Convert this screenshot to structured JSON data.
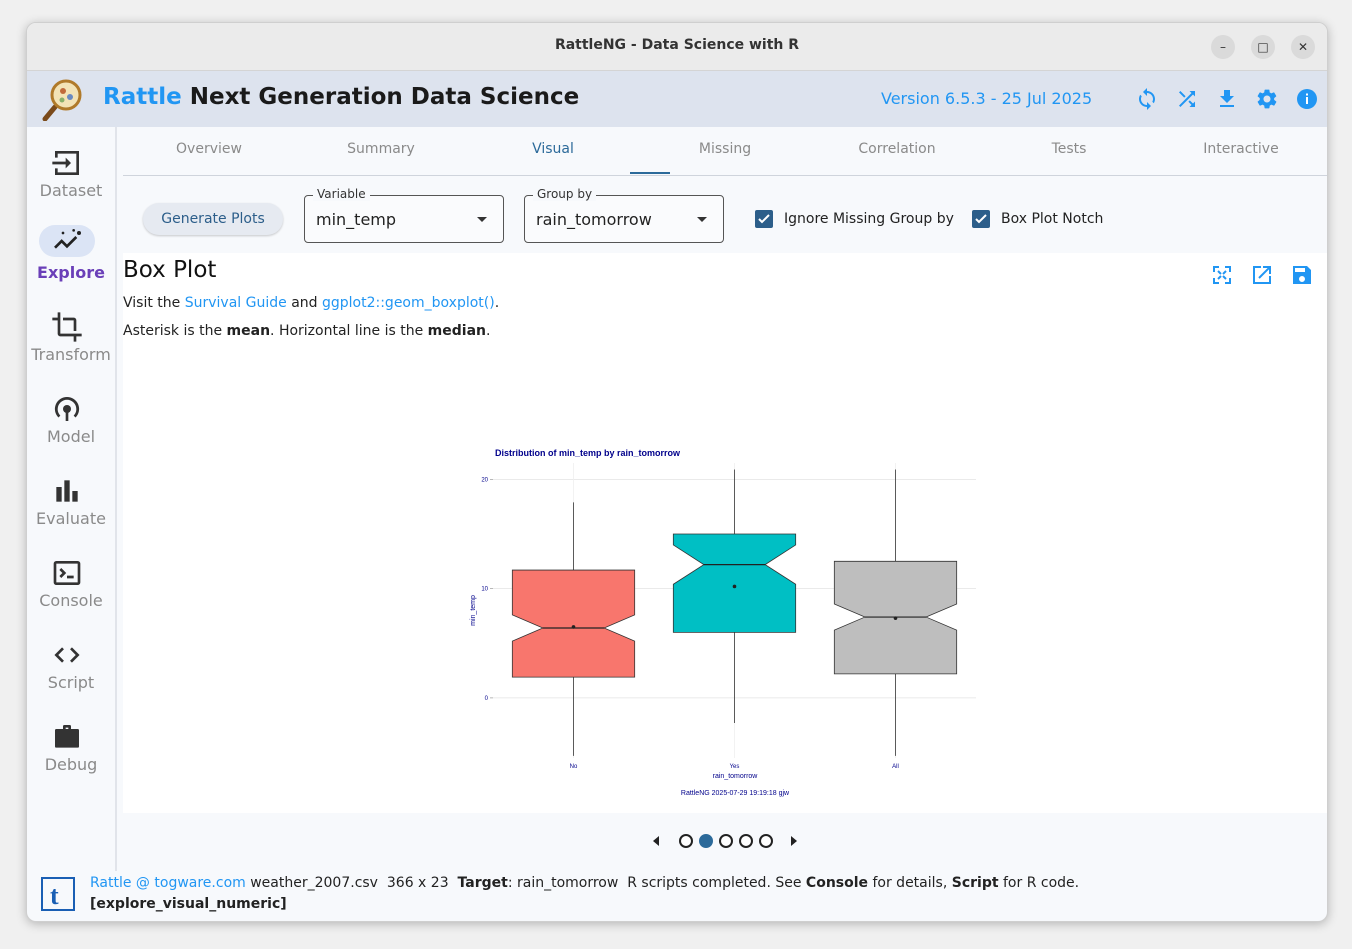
{
  "window": {
    "title": "RattleNG - Data Science with R",
    "controls": [
      "–",
      "□",
      "✕"
    ]
  },
  "appbar": {
    "title_accent": "Rattle",
    "title_rest": "Next Generation Data Science",
    "version": "Version 6.5.3 - 25 Jul 2025",
    "icons": [
      "refresh-icon",
      "shuffle-icon",
      "download-icon",
      "settings-icon",
      "info-icon"
    ],
    "accent_color": "#2196f3"
  },
  "sidebar": {
    "items": [
      {
        "label": "Dataset",
        "icon": "dataset-icon"
      },
      {
        "label": "Explore",
        "icon": "explore-icon",
        "active": true
      },
      {
        "label": "Transform",
        "icon": "transform-icon"
      },
      {
        "label": "Model",
        "icon": "model-icon"
      },
      {
        "label": "Evaluate",
        "icon": "evaluate-icon"
      },
      {
        "label": "Console",
        "icon": "console-icon"
      },
      {
        "label": "Script",
        "icon": "script-icon"
      },
      {
        "label": "Debug",
        "icon": "debug-icon"
      }
    ]
  },
  "tabs": [
    "Overview",
    "Summary",
    "Visual",
    "Missing",
    "Correlation",
    "Tests",
    "Interactive"
  ],
  "active_tab": "Visual",
  "toolbar": {
    "generate_label": "Generate Plots",
    "variable_legend": "Variable",
    "variable_value": "min_temp",
    "groupby_legend": "Group by",
    "groupby_value": "rain_tomorrow",
    "ignore_missing_label": "Ignore Missing Group by",
    "ignore_missing_checked": true,
    "notch_label": "Box Plot Notch",
    "notch_checked": true
  },
  "content": {
    "heading": "Box Plot",
    "visit_prefix": "Visit the",
    "link1": "Survival Guide",
    "and": "and",
    "link2": "ggplot2::geom_boxplot()",
    "period": ".",
    "note_a": "Asterisk is the",
    "note_mean": "mean",
    "note_b": ". Horizontal line is the",
    "note_median": "median",
    "note_c": "."
  },
  "chart_data": {
    "type": "boxplot",
    "title": "Distribution of min_temp by rain_tomorrow",
    "xlabel": "rain_tomorrow",
    "ylabel": "min_temp",
    "caption": "RattleNG 2025-07-29 19:19:18 gjw",
    "ylim": [
      -5.5,
      21.5
    ],
    "yticks": [
      0,
      10,
      20
    ],
    "notched": true,
    "grid": true,
    "categories": [
      "No",
      "Yes",
      "All"
    ],
    "colors": [
      "#f8766d",
      "#00bfc4",
      "#bebebe"
    ],
    "boxes": [
      {
        "min": -5.3,
        "q1": 1.9,
        "median": 6.4,
        "q3": 11.7,
        "max": 17.9,
        "mean": 6.5,
        "notch_low": 5.2,
        "notch_high": 7.6
      },
      {
        "min": -2.3,
        "q1": 6.0,
        "median": 12.2,
        "q3": 15.0,
        "max": 20.9,
        "mean": 10.2,
        "notch_low": 10.4,
        "notch_high": 14.0
      },
      {
        "min": -5.3,
        "q1": 2.2,
        "median": 7.4,
        "q3": 12.5,
        "max": 20.9,
        "mean": 7.3,
        "notch_low": 6.2,
        "notch_high": 8.6
      }
    ]
  },
  "pager": {
    "count": 5,
    "active": 2
  },
  "status": {
    "rattle_at": "Rattle @",
    "domain": "togware.com",
    "file": "weather_2007.csv",
    "dims": "366 x 23",
    "target_label": "Target",
    "target_value": ": rain_tomorrow",
    "msg_a": "R scripts completed. See",
    "msg_console": "Console",
    "msg_b": "for details,",
    "msg_script": "Script",
    "msg_c": "for R code.",
    "context": "[explore_visual_numeric]"
  }
}
